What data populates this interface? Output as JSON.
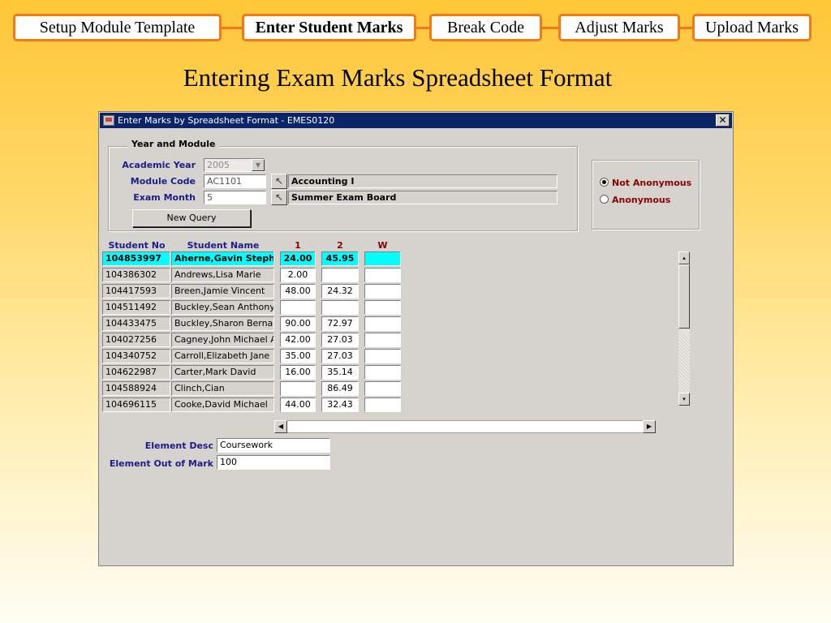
{
  "steps": [
    {
      "label": "Setup Module Template",
      "active": false
    },
    {
      "label": "Enter Student Marks",
      "active": true
    },
    {
      "label": "Break Code",
      "active": false
    },
    {
      "label": "Adjust Marks",
      "active": false
    },
    {
      "label": "Upload Marks",
      "active": false
    }
  ],
  "page_title": "Entering Exam Marks Spreadsheet Format",
  "window": {
    "title": "Enter Marks by Spreadsheet Format - EMES0120",
    "close_glyph": "✕"
  },
  "year_module": {
    "legend": "Year and Module",
    "academic_year_label": "Academic Year",
    "academic_year_value": "2005",
    "module_code_label": "Module Code",
    "module_code_value": "AC1101",
    "module_name": "Accounting I",
    "exam_month_label": "Exam Month",
    "exam_month_value": "5",
    "exam_month_desc": "Summer Exam Board",
    "new_query_label": "New Query"
  },
  "anonymity": {
    "options": [
      {
        "label": "Not Anonymous",
        "selected": true
      },
      {
        "label": "Anonymous",
        "selected": false
      }
    ]
  },
  "table": {
    "headers": {
      "student_no": "Student No",
      "student_name": "Student Name",
      "col1": "1",
      "col2": "2",
      "colw": "W"
    },
    "rows": [
      {
        "no": "104853997",
        "name": "Aherne,Gavin Stephe",
        "m1": "24.00",
        "m2": "45.95",
        "w": ""
      },
      {
        "no": "104386302",
        "name": "Andrews,Lisa Marie",
        "m1": "2.00",
        "m2": "",
        "w": ""
      },
      {
        "no": "104417593",
        "name": "Breen,Jamie Vincent",
        "m1": "48.00",
        "m2": "24.32",
        "w": ""
      },
      {
        "no": "104511492",
        "name": "Buckley,Sean Anthony",
        "m1": "",
        "m2": "",
        "w": ""
      },
      {
        "no": "104433475",
        "name": "Buckley,Sharon Bernad",
        "m1": "90.00",
        "m2": "72.97",
        "w": ""
      },
      {
        "no": "104027256",
        "name": "Cagney,John Michael Ai",
        "m1": "42.00",
        "m2": "27.03",
        "w": ""
      },
      {
        "no": "104340752",
        "name": "Carroll,Elizabeth Jane",
        "m1": "35.00",
        "m2": "27.03",
        "w": ""
      },
      {
        "no": "104622987",
        "name": "Carter,Mark David",
        "m1": "16.00",
        "m2": "35.14",
        "w": ""
      },
      {
        "no": "104588924",
        "name": "Clinch,Cian",
        "m1": "",
        "m2": "86.49",
        "w": ""
      },
      {
        "no": "104696115",
        "name": "Cooke,David Michael",
        "m1": "44.00",
        "m2": "32.43",
        "w": ""
      }
    ]
  },
  "element": {
    "desc_label": "Element Desc",
    "desc_value": "Coursework",
    "out_of_label": "Element Out of Mark",
    "out_of_value": "100"
  },
  "colors": {
    "accent_orange": "#f07a1a",
    "titlebar": "#0a246a",
    "selected_row": "#00ffff",
    "label_blue": "#1c1c8c",
    "label_red": "#8b0000"
  }
}
